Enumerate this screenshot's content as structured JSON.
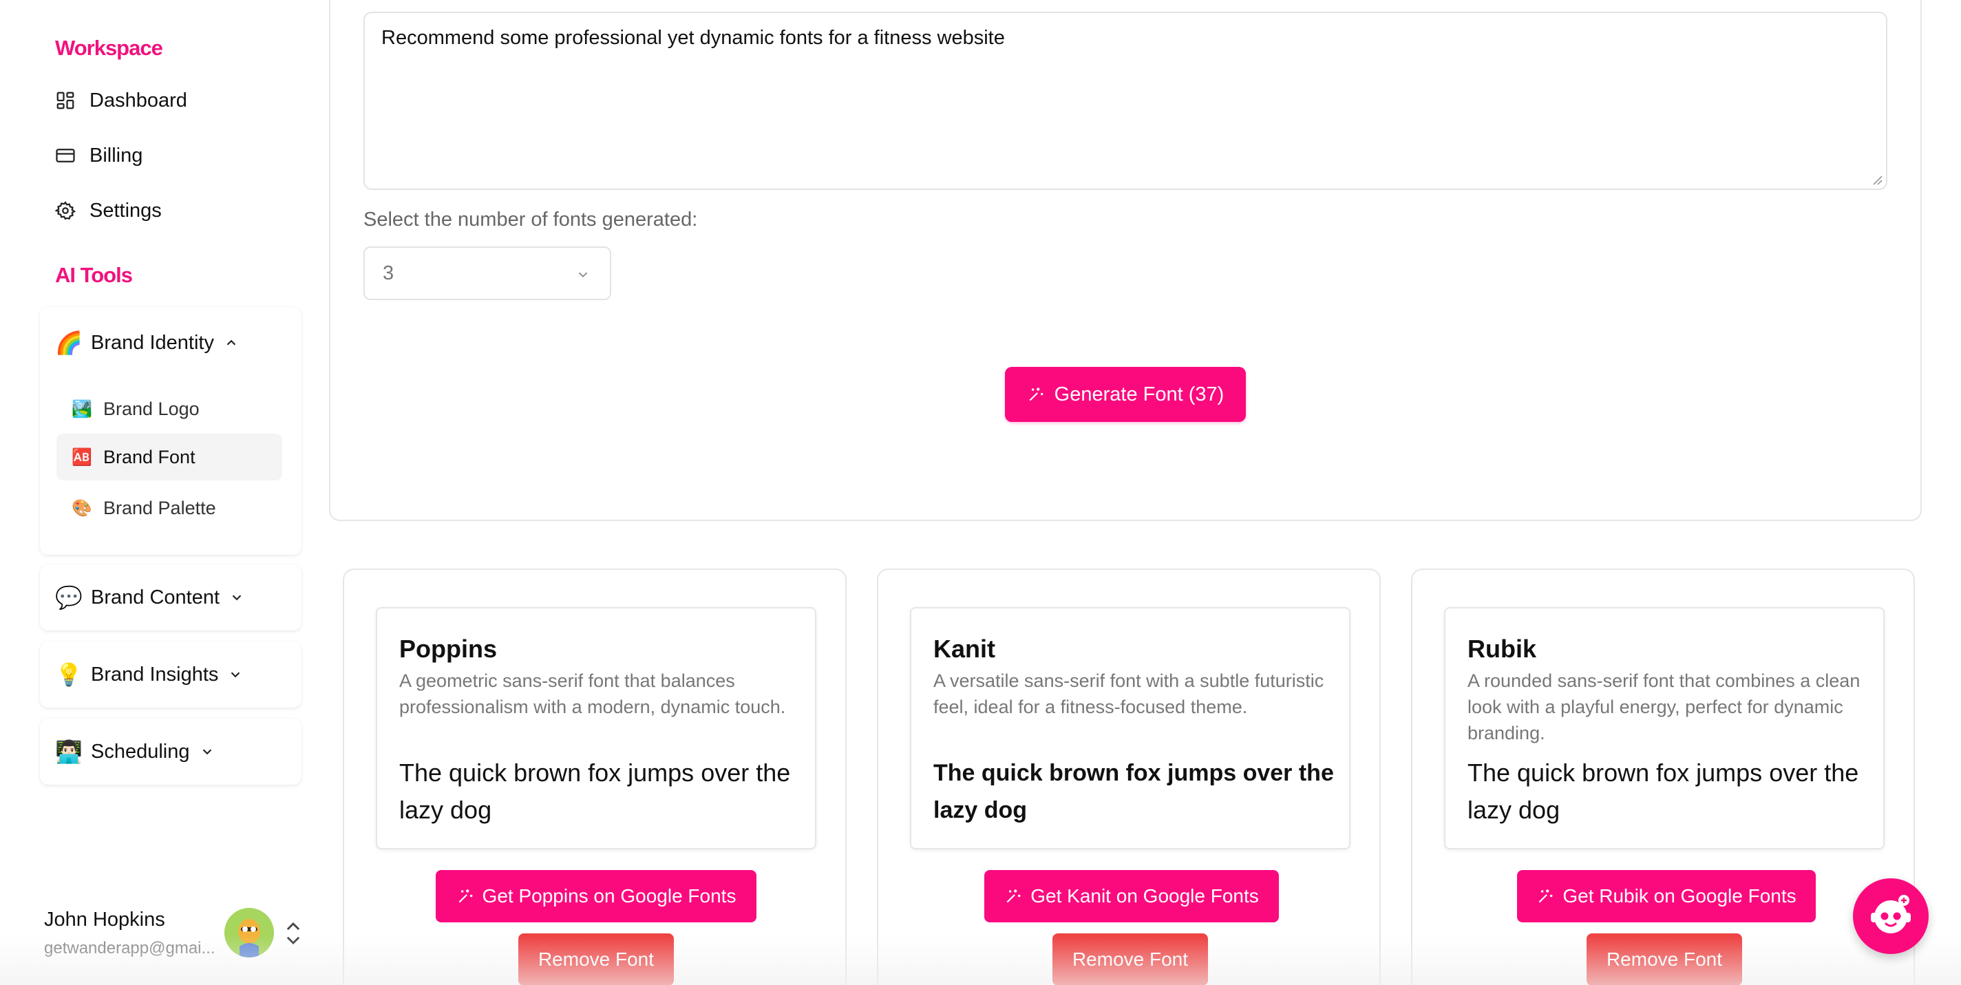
{
  "sidebar": {
    "workspace_title": "Workspace",
    "workspace_items": [
      {
        "label": "Dashboard",
        "icon": "dashboard-icon"
      },
      {
        "label": "Billing",
        "icon": "card-icon"
      },
      {
        "label": "Settings",
        "icon": "gear-icon"
      }
    ],
    "ai_tools_title": "AI Tools",
    "groups": [
      {
        "label": "Brand Identity",
        "emoji": "🌈",
        "expanded": true,
        "items": [
          {
            "label": "Brand Logo",
            "emoji": "🏞️"
          },
          {
            "label": "Brand Font",
            "emoji": "🆎",
            "active": true
          },
          {
            "label": "Brand Palette",
            "emoji": "🎨"
          }
        ]
      },
      {
        "label": "Brand Content",
        "emoji": "💬",
        "expanded": false
      },
      {
        "label": "Brand Insights",
        "emoji": "💡",
        "expanded": false
      },
      {
        "label": "Scheduling",
        "emoji": "👨🏻‍💻",
        "expanded": false
      }
    ],
    "user": {
      "name": "John Hopkins",
      "email": "getwanderapp@gmai..."
    }
  },
  "main": {
    "prompt_text": "Recommend some professional yet dynamic fonts for a fitness website",
    "select_label": "Select the number of fonts generated:",
    "select_value": "3",
    "generate_label": "Generate Font (37)"
  },
  "fonts": [
    {
      "name": "Poppins",
      "description": "A geometric sans-serif font that balances professionalism with a modern, dynamic touch.",
      "sample": "The quick brown fox jumps over the lazy dog",
      "get_label": "Get Poppins on Google Fonts",
      "remove_label": "Remove Font"
    },
    {
      "name": "Kanit",
      "description": "A versatile sans-serif font with a subtle futuristic feel, ideal for a fitness-focused theme.",
      "sample": "The quick brown fox jumps over the lazy dog",
      "get_label": "Get Kanit on Google Fonts",
      "remove_label": "Remove Font"
    },
    {
      "name": "Rubik",
      "description": "A rounded sans-serif font that combines a clean look with a playful energy, perfect for dynamic branding.",
      "sample": "The quick brown fox jumps over the lazy dog",
      "get_label": "Get Rubik on Google Fonts",
      "remove_label": "Remove Font"
    }
  ],
  "colors": {
    "accent": "#fb0a7e",
    "danger": "#ef4444",
    "section_title": "#f0127e"
  }
}
